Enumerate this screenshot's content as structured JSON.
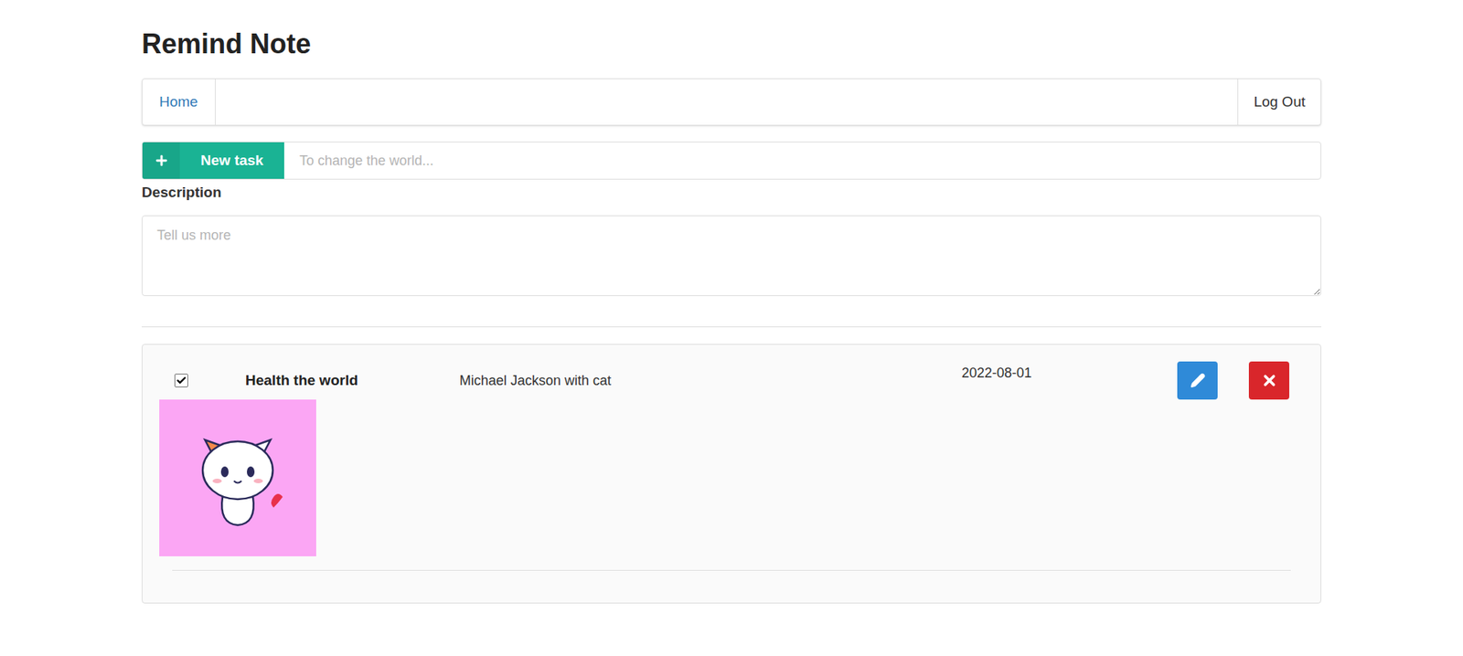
{
  "app": {
    "title": "Remind Note"
  },
  "nav": {
    "items": [
      {
        "label": "Home",
        "selected": true
      }
    ],
    "logout": "Log Out"
  },
  "new_task": {
    "button": "New task",
    "placeholder": "To change the world..."
  },
  "description": {
    "label": "Description",
    "placeholder": "Tell us more"
  },
  "tasks": [
    {
      "title": "Health the world",
      "description": "Michael Jackson with cat",
      "date": "2022-08-01",
      "checked": true
    }
  ]
}
